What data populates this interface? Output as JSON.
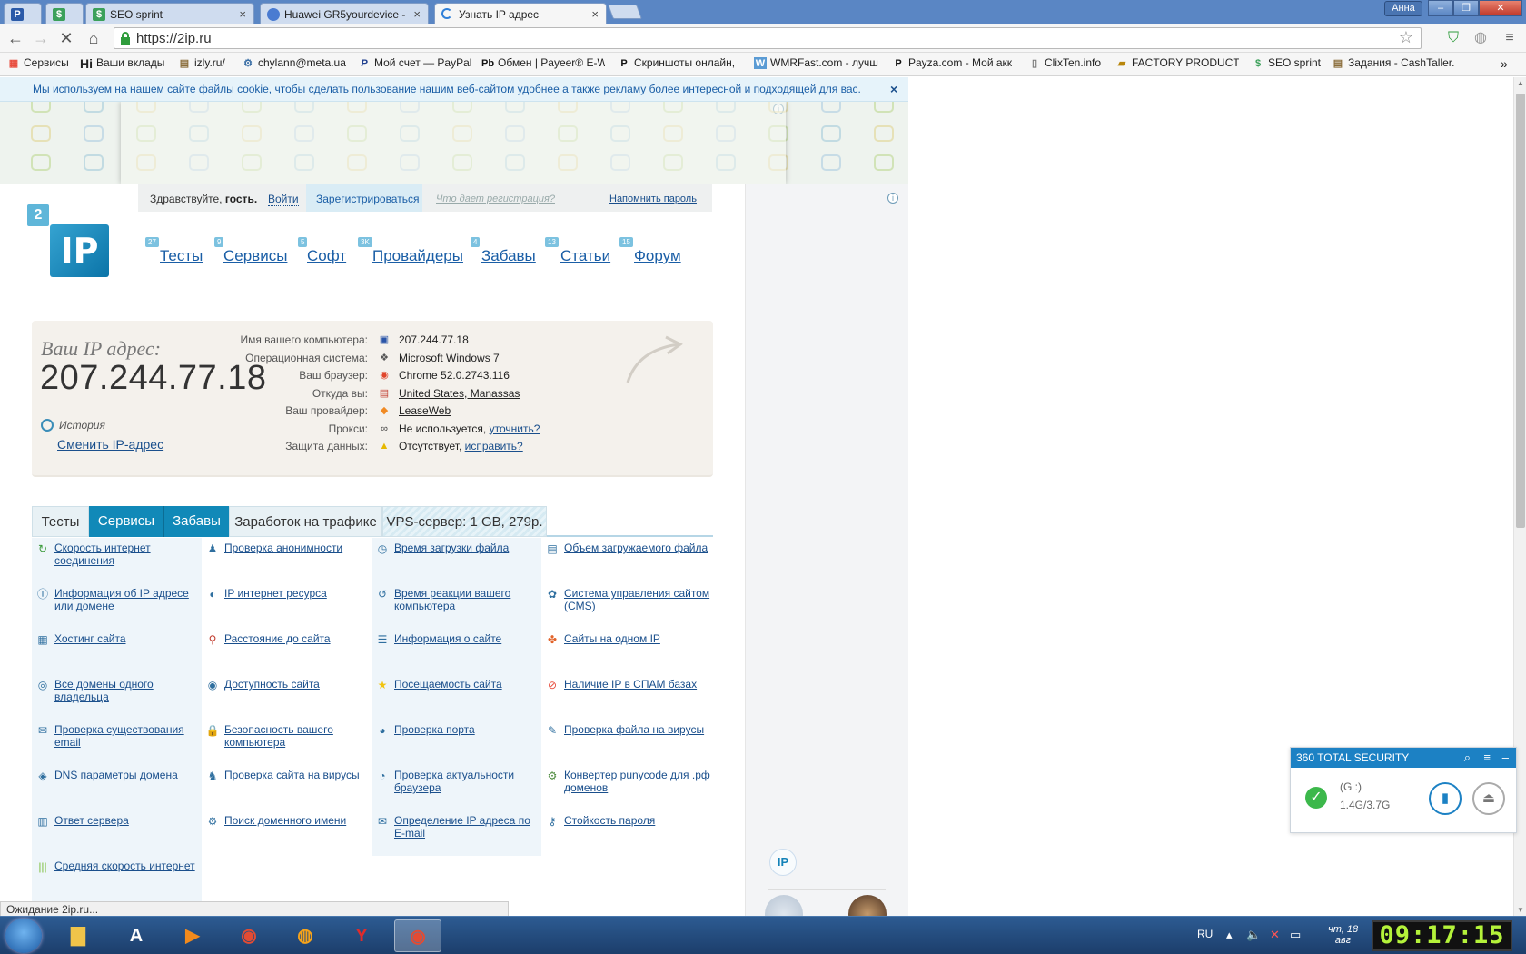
{
  "browser": {
    "tabs": [
      {
        "label": "P",
        "favicon": "P",
        "favicon_color": "#2b5aa8"
      },
      {
        "label": "",
        "favicon": "$",
        "favicon_color": "#3ba05a"
      },
      {
        "label": "SEO sprint",
        "favicon": "$",
        "favicon_color": "#3ba05a"
      },
      {
        "label": "Huawei GR5yourdevice - ",
        "favicon": "",
        "favicon_color": "#4a7bd1"
      },
      {
        "label": "Узнать IP адрес",
        "favicon": "",
        "favicon_color": "#2f7fd8"
      }
    ],
    "user": "Анна",
    "url": "https://2ip.ru",
    "bookmarks": [
      {
        "label": "Сервисы",
        "icon": "apps-icon"
      },
      {
        "label": "Ваши вклады",
        "icon": "Hi"
      },
      {
        "label": "izly.ru/",
        "icon": "izly-icon"
      },
      {
        "label": "chylann@meta.ua",
        "icon": "meta-icon"
      },
      {
        "label": "Мой счет — PayPal",
        "icon": "P"
      },
      {
        "label": "Обмен | Payeer® E-W",
        "icon": "Pb"
      },
      {
        "label": "Скриншоты онлайн,",
        "icon": "P"
      },
      {
        "label": "WMRFast.com - лучш",
        "icon": "W"
      },
      {
        "label": "Payza.com - Мой акк",
        "icon": "P"
      },
      {
        "label": "ClixTen.info",
        "icon": "page-icon"
      },
      {
        "label": "FACTORY PRODUCTIO",
        "icon": "factory-icon"
      },
      {
        "label": "SEO sprint",
        "icon": "$"
      },
      {
        "label": "Задания - CashTaller.",
        "icon": "cash-icon"
      }
    ],
    "status": "Ожидание 2ip.ru..."
  },
  "site": {
    "cookie_notice": "Мы используем на нашем сайте файлы cookie, чтобы сделать пользование нашим веб-сайтом удобнее а также рекламу более интересной и подходящей для вас.",
    "greeting_prefix": "Здравствуйте,",
    "greeting_name": "гость.",
    "login": "Войти",
    "register": "Зарегистрироваться",
    "why_register": "Что дает регистрация?",
    "remind": "Напомнить пароль",
    "logo_badge": "2",
    "logo_text": "IP",
    "nav": [
      {
        "label": "Тесты",
        "badge": "27"
      },
      {
        "label": "Сервисы",
        "badge": "9"
      },
      {
        "label": "Софт",
        "badge": "5"
      },
      {
        "label": "Провайдеры",
        "badge": "3K"
      },
      {
        "label": "Забавы",
        "badge": "4"
      },
      {
        "label": "Статьи",
        "badge": "13"
      },
      {
        "label": "Форум",
        "badge": "15"
      }
    ],
    "ip_label": "Ваш IP адрес:",
    "ip_value": "207.244.77.18",
    "history": "История",
    "change_ip": "Сменить IP-адрес",
    "info": [
      {
        "key": "Имя вашего компьютера:",
        "value": "207.244.77.18",
        "link": false,
        "icon": "computer-icon",
        "color": "#2a55a8"
      },
      {
        "key": "Операционная система:",
        "value": "Microsoft Windows 7",
        "link": false,
        "icon": "windows-icon",
        "color": "#555"
      },
      {
        "key": "Ваш браузер:",
        "value": "Chrome 52.0.2743.116",
        "link": false,
        "icon": "chrome-icon",
        "color": "#e0452b"
      },
      {
        "key": "Откуда вы:",
        "value": "United States, Manassas",
        "link": true,
        "icon": "us-flag-icon",
        "color": "#c0392b"
      },
      {
        "key": "Ваш провайдер:",
        "value": "LeaseWeb",
        "link": true,
        "icon": "provider-icon",
        "color": "#f08a24"
      },
      {
        "key": "Прокси:",
        "value": "Не используется,",
        "extra": "уточнить?",
        "link": false,
        "icon": "glasses-icon",
        "color": "#444"
      },
      {
        "key": "Защита данных:",
        "value": "Отсутствует,",
        "extra": "исправить?",
        "link": false,
        "icon": "warning-icon",
        "color": "#e6b800"
      }
    ],
    "tabs": [
      "Тесты",
      "Сервисы",
      "Забавы",
      "Заработок на трафике",
      "VPS-сервер: 1 GB, 279р."
    ],
    "services": [
      {
        "label": "Скорость интернет соединения",
        "icon": "speed-icon"
      },
      {
        "label": "Проверка анонимности",
        "icon": "anon-icon"
      },
      {
        "label": "Время загрузки файла",
        "icon": "clock-icon"
      },
      {
        "label": "Объем загружаемого файла",
        "icon": "file-size-icon"
      },
      {
        "label": "Информация об IP адресе или домене",
        "icon": "ip-info-icon"
      },
      {
        "label": "IP интернет ресурса",
        "icon": "ip-resource-icon"
      },
      {
        "label": "Время реакции вашего компьютера",
        "icon": "reaction-icon"
      },
      {
        "label": "Система управления сайтом (CMS)",
        "icon": "cms-icon"
      },
      {
        "label": "Хостинг сайта",
        "icon": "hosting-icon"
      },
      {
        "label": "Расстояние до сайта",
        "icon": "pin-icon"
      },
      {
        "label": "Информация о сайте",
        "icon": "site-info-icon"
      },
      {
        "label": "Сайты на одном IP",
        "icon": "sites-icon"
      },
      {
        "label": "Все домены одного владельца",
        "icon": "domains-icon"
      },
      {
        "label": "Доступность сайта",
        "icon": "availability-icon"
      },
      {
        "label": "Посещаемость сайта",
        "icon": "star-icon"
      },
      {
        "label": "Наличие IP в СПАМ базах",
        "icon": "spam-icon"
      },
      {
        "label": "Проверка существования email",
        "icon": "email-icon"
      },
      {
        "label": "Безопасность вашего компьютера",
        "icon": "lock-icon"
      },
      {
        "label": "Проверка порта",
        "icon": "port-icon"
      },
      {
        "label": "Проверка файла на вирусы",
        "icon": "virus-file-icon"
      },
      {
        "label": "DNS параметры домена",
        "icon": "dns-icon"
      },
      {
        "label": "Проверка сайта на вирусы",
        "icon": "virus-site-icon"
      },
      {
        "label": "Проверка актуальности браузера",
        "icon": "browser-icon"
      },
      {
        "label": "Конвертер punycode для .рф доменов",
        "icon": "punycode-icon"
      },
      {
        "label": "Ответ сервера",
        "icon": "server-icon"
      },
      {
        "label": "Поиск доменного имени",
        "icon": "search-domain-icon"
      },
      {
        "label": "Определение IP адреса по E-mail",
        "icon": "ip-email-icon"
      },
      {
        "label": "Стойкость пароля",
        "icon": "password-icon"
      },
      {
        "label": "Средняя скорость интернет",
        "icon": "avg-speed-icon"
      }
    ],
    "sidebar_logo": "IP"
  },
  "security_popup": {
    "title": "360 TOTAL SECURITY",
    "drive": "(G :)",
    "size": "1.4G/3.7G"
  },
  "taskbar": {
    "lang": "RU",
    "date_line1": "чт, 18",
    "date_line2": "авг",
    "clock": "09:17:15"
  }
}
